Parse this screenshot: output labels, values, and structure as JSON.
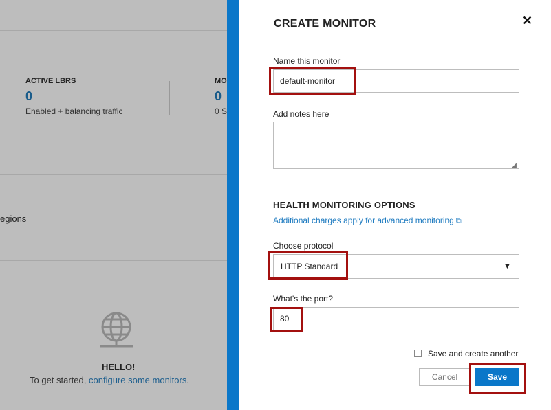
{
  "background": {
    "stats": [
      {
        "label": "ACTIVE LBRS",
        "value": "0",
        "sub": "Enabled + balancing traffic"
      },
      {
        "label": "MO",
        "value": "0",
        "sub": "0 S"
      }
    ],
    "regions_text": "egions",
    "empty_state": {
      "icon": "globe-icon",
      "heading": "HELLO!",
      "text_prefix": "To get started,",
      "link": "configure some monitors",
      "text_suffix": "."
    }
  },
  "modal": {
    "title": "CREATE MONITOR",
    "close_icon": "close-icon",
    "name_label": "Name this monitor",
    "name_value": "default-monitor",
    "notes_label": "Add notes here",
    "notes_value": "",
    "section_title": "HEALTH MONITORING OPTIONS",
    "charges_link": "Additional charges apply for advanced monitoring",
    "protocol_label": "Choose protocol",
    "protocol_value": "HTTP Standard",
    "port_label": "What's the port?",
    "port_value": "80",
    "save_another_label": "Save and create another",
    "save_another_checked": false,
    "cancel_label": "Cancel",
    "save_label": "Save"
  },
  "colors": {
    "accent": "#0a77c9",
    "highlight": "#a3100f",
    "link": "#1e7bc0"
  }
}
